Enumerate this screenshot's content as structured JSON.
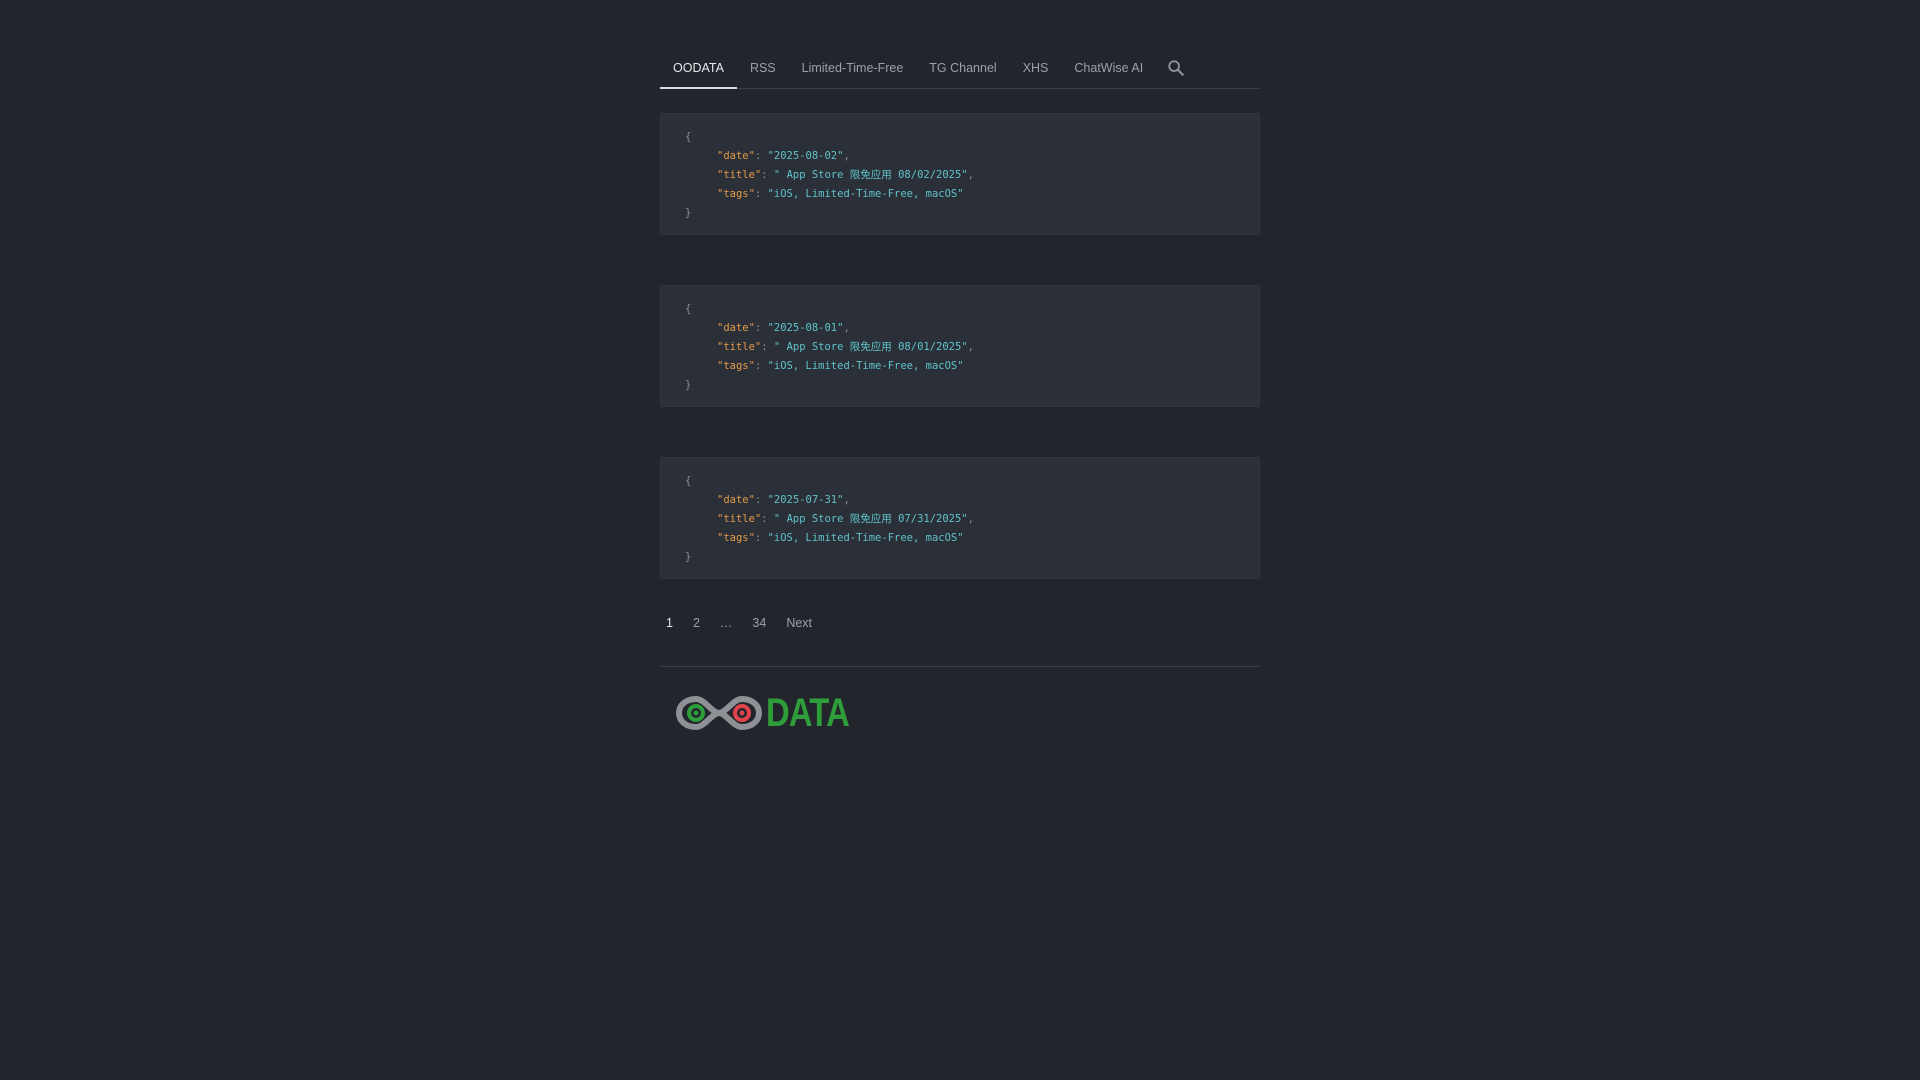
{
  "nav": {
    "items": [
      {
        "label": "OODATA",
        "active": true
      },
      {
        "label": "RSS",
        "active": false
      },
      {
        "label": "Limited-Time-Free",
        "active": false
      },
      {
        "label": "TG Channel",
        "active": false
      },
      {
        "label": "XHS",
        "active": false
      },
      {
        "label": "ChatWise AI",
        "active": false
      }
    ],
    "search_icon": "search-icon"
  },
  "json_syntax": {
    "open_brace": "{",
    "close_brace": "}",
    "colon": ": ",
    "comma": ","
  },
  "posts": [
    {
      "date_key": "\"date\"",
      "date": "\"2025-08-02\"",
      "title_key": "\"title\"",
      "title": "\" App Store 限免应用 08/02/2025\"",
      "tags_key": "\"tags\"",
      "tags": "\"iOS, Limited-Time-Free, macOS\""
    },
    {
      "date_key": "\"date\"",
      "date": "\"2025-08-01\"",
      "title_key": "\"title\"",
      "title": "\" App Store 限免应用 08/01/2025\"",
      "tags_key": "\"tags\"",
      "tags": "\"iOS, Limited-Time-Free, macOS\""
    },
    {
      "date_key": "\"date\"",
      "date": "\"2025-07-31\"",
      "title_key": "\"title\"",
      "title": "\" App Store 限免应用 07/31/2025\"",
      "tags_key": "\"tags\"",
      "tags": "\"iOS, Limited-Time-Free, macOS\""
    }
  ],
  "pagination": {
    "pages": [
      "1",
      "2",
      "…",
      "34"
    ],
    "current": "1",
    "next_label": "Next"
  },
  "footer": {
    "logo_text": "DATA",
    "logo_icon": "infinity-logo-icon"
  },
  "colors": {
    "background": "#22252c",
    "card": "#2b2f37",
    "json_key": "#e59b4a",
    "json_string": "#5fc4c9",
    "logo_green": "#2f9e3a",
    "logo_red": "#e0434a",
    "logo_gray": "#8e9096"
  }
}
